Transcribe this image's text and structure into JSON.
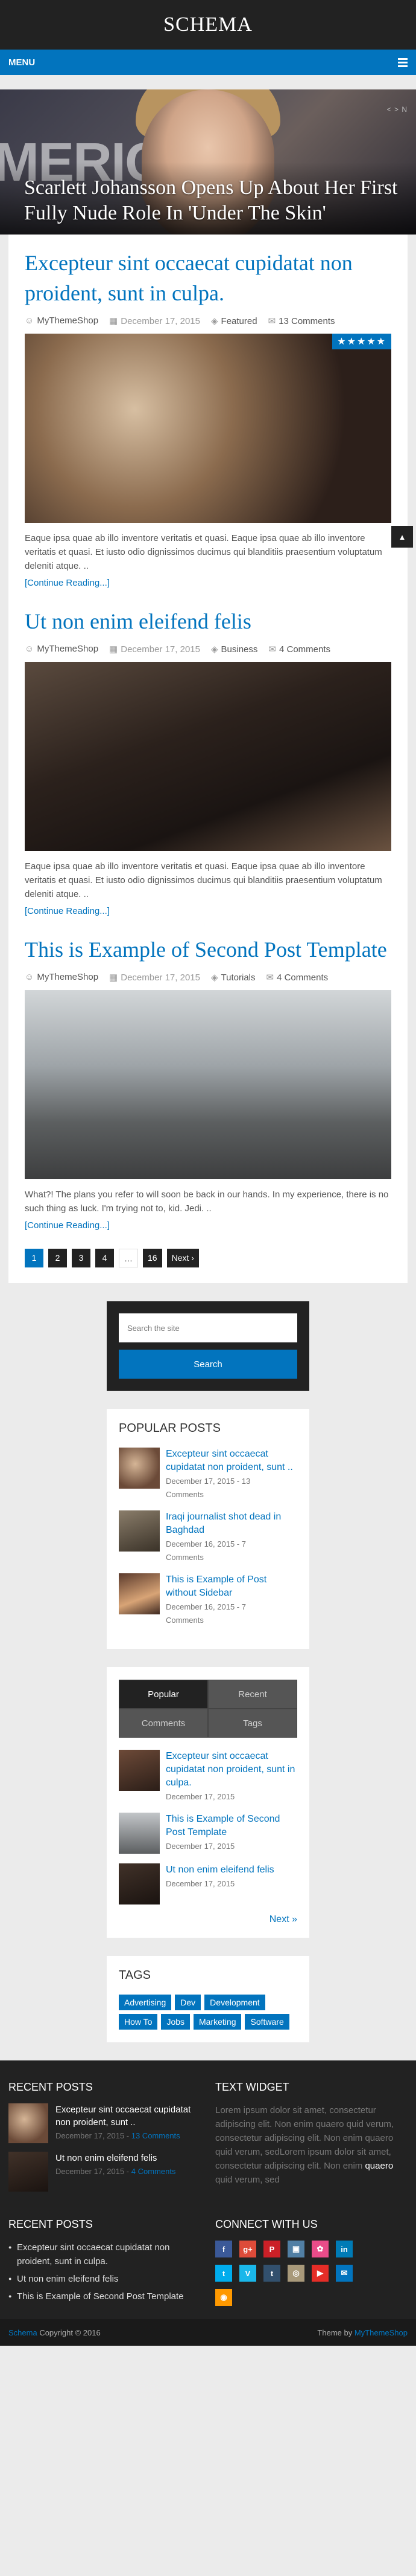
{
  "header": {
    "logo": "SCHEMA",
    "menu_label": "MENU"
  },
  "featured": {
    "bg_text": "MERIC",
    "slider_label": "< > N",
    "title": "Scarlett Johansson Opens Up About Her First Fully Nude Role In 'Under The Skin'"
  },
  "posts": [
    {
      "title": "Excepteur sint occaecat cupidatat non proident, sunt in culpa.",
      "author": "MyThemeShop",
      "date": "December 17, 2015",
      "category": "Featured",
      "comments": "13 Comments",
      "rating": "★★★★★",
      "excerpt": "Eaque ipsa quae ab illo inventore veritatis et quasi. Eaque ipsa quae ab illo inventore veritatis et quasi. Et iusto odio dignissimos ducimus qui blanditiis praesentium voluptatum deleniti atque. ..",
      "read_more": "[Continue Reading...]"
    },
    {
      "title": "Ut non enim eleifend felis",
      "author": "MyThemeShop",
      "date": "December 17, 2015",
      "category": "Business",
      "comments": "4 Comments",
      "excerpt": "Eaque ipsa quae ab illo inventore veritatis et quasi. Eaque ipsa quae ab illo inventore veritatis et quasi. Et iusto odio dignissimos ducimus qui blanditiis praesentium voluptatum deleniti atque. ..",
      "read_more": "[Continue Reading...]"
    },
    {
      "title": "This is Example of Second Post Template",
      "author": "MyThemeShop",
      "date": "December 17, 2015",
      "category": "Tutorials",
      "comments": "4 Comments",
      "excerpt": "What?! The plans you refer to will soon be back in our hands. In my experience, there is no such thing as luck. I'm trying not to, kid. Jedi. ..",
      "read_more": "[Continue Reading...]"
    }
  ],
  "pagination": {
    "p1": "1",
    "p2": "2",
    "p3": "3",
    "p4": "4",
    "dots": "…",
    "last": "16",
    "next": "Next ›"
  },
  "search": {
    "placeholder": "Search the site",
    "button": "Search"
  },
  "popular": {
    "title": "POPULAR POSTS",
    "items": [
      {
        "title": "Excepteur sint occaecat cupidatat non proident, sunt ..",
        "date": "December 17, 2015 - 13",
        "comments": "Comments"
      },
      {
        "title": "Iraqi journalist shot dead in Baghdad",
        "date": "December 16, 2015 - 7",
        "comments": "Comments"
      },
      {
        "title": "This is Example of Post without Sidebar",
        "date": "December 16, 2015 - 7",
        "comments": "Comments"
      }
    ]
  },
  "tabs_widget": {
    "tab_popular": "Popular",
    "tab_recent": "Recent",
    "tab_comments": "Comments",
    "tab_tags": "Tags",
    "items": [
      {
        "title": "Excepteur sint occaecat cupidatat non proident, sunt in culpa.",
        "date": "December 17, 2015"
      },
      {
        "title": "This is Example of Second Post Template",
        "date": "December 17, 2015"
      },
      {
        "title": "Ut non enim eleifend felis",
        "date": "December 17, 2015"
      }
    ],
    "next": "Next »"
  },
  "tags": {
    "title": "TAGS",
    "items": [
      "Advertising",
      "Dev",
      "Development",
      "How To",
      "Jobs",
      "Marketing",
      "Software"
    ]
  },
  "footer": {
    "recent_title": "RECENT POSTS",
    "recent_items": [
      {
        "title": "Excepteur sint occaecat cupidatat non proident, sunt ..",
        "date": "December 17, 2015 - ",
        "comments": "13 Comments"
      },
      {
        "title": "Ut non enim eleifend felis",
        "date": "December 17, 2015 - ",
        "comments": "4 Comments"
      }
    ],
    "text_widget_title": "TEXT WIDGET",
    "text_widget_pre": "Lorem ipsum dolor sit amet, consectetur adipiscing elit. Non enim quaero quid verum, consectetur adipiscing elit. Non enim quaero quid verum, sedLorem ipsum dolor sit amet, consectetur adipiscing elit. Non enim ",
    "text_widget_bold": "quaero",
    "text_widget_post": " quid verum, sed",
    "recent_list_title": "RECENT POSTS",
    "recent_list": [
      "Excepteur sint occaecat cupidatat non proident, sunt in culpa.",
      "Ut non enim eleifend felis",
      "This is Example of Second Post Template"
    ],
    "connect_title": "CONNECT WITH US",
    "social": [
      {
        "icon": "f",
        "color": "#3b5998"
      },
      {
        "icon": "g+",
        "color": "#dd4b39"
      },
      {
        "icon": "P",
        "color": "#cb2027"
      },
      {
        "icon": "▣",
        "color": "#517fa4"
      },
      {
        "icon": "✿",
        "color": "#ea4c89"
      },
      {
        "icon": "in",
        "color": "#007bb6"
      },
      {
        "icon": "t",
        "color": "#00aced"
      },
      {
        "icon": "V",
        "color": "#1ab7ea"
      },
      {
        "icon": "t",
        "color": "#32506d"
      },
      {
        "icon": "◎",
        "color": "#a8997a"
      },
      {
        "icon": "▶",
        "color": "#e52d27"
      },
      {
        "icon": "✉",
        "color": "#0274be"
      },
      {
        "icon": "◉",
        "color": "#ff9900"
      }
    ]
  },
  "copyright": {
    "site": "Schema",
    "text": " Copyright © 2016",
    "theme_pre": "Theme by ",
    "theme_link": "MyThemeShop"
  }
}
